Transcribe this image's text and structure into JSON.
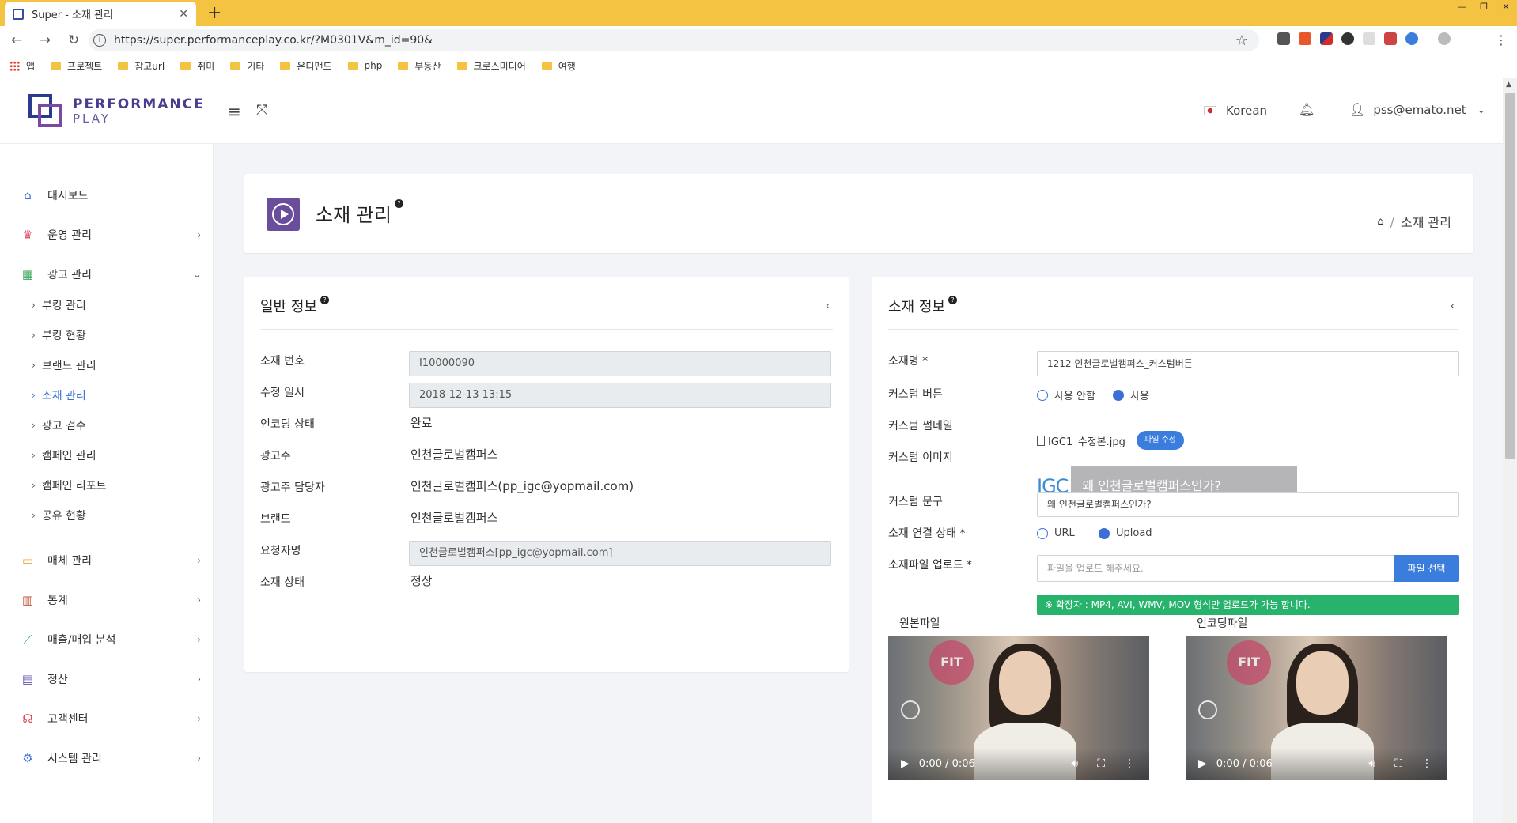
{
  "browser": {
    "tab_title": "Super - 소재 관리",
    "url": "https://super.performanceplay.co.kr/?M0301V&m_id=90&",
    "bookmarks": [
      "앱",
      "프로젝트",
      "참고url",
      "취미",
      "기타",
      "온디맨드",
      "php",
      "부동산",
      "크로스미디어",
      "여행"
    ]
  },
  "header": {
    "logo_line1": "PERFORMANCE",
    "logo_line2": "PLAY",
    "language": "Korean",
    "user_email": "pss@emato.net"
  },
  "sidebar": {
    "items": [
      {
        "label": "대시보드",
        "icon": "home-icon"
      },
      {
        "label": "운영 관리",
        "icon": "crown-icon"
      },
      {
        "label": "광고 관리",
        "icon": "grid-icon"
      },
      {
        "label": "매체 관리",
        "icon": "monitor-icon"
      },
      {
        "label": "통계",
        "icon": "bar-chart-icon"
      },
      {
        "label": "매출/매입 분석",
        "icon": "line-chart-icon"
      },
      {
        "label": "정산",
        "icon": "calculator-icon"
      },
      {
        "label": "고객센터",
        "icon": "headset-icon"
      },
      {
        "label": "시스템 관리",
        "icon": "gear-icon"
      }
    ],
    "sub_items": [
      "부킹 관리",
      "부킹 현황",
      "브랜드 관리",
      "소재 관리",
      "광고 검수",
      "캠페인 관리",
      "캠페인 리포트",
      "공유 현황"
    ],
    "active_sub": "소재 관리",
    "active_color": "#3b6fd6"
  },
  "page": {
    "title": "소재 관리",
    "breadcrumb": "소재 관리"
  },
  "general": {
    "title": "일반 정보",
    "rows": {
      "material_no_label": "소재 번호",
      "material_no": "I10000090",
      "modified_label": "수정 일시",
      "modified": "2018-12-13 13:15",
      "encoding_label": "인코딩 상태",
      "encoding": "완료",
      "advertiser_label": "광고주",
      "advertiser": "인천글로벌캠퍼스",
      "manager_label": "광고주 담당자",
      "manager": "인천글로벌캠퍼스(pp_igc@yopmail.com)",
      "brand_label": "브랜드",
      "brand": "인천글로벌캠퍼스",
      "requester_label": "요청자명",
      "requester": "인천글로벌캠퍼스[pp_igc@yopmail.com]",
      "status_label": "소재 상태",
      "status": "정상"
    }
  },
  "material": {
    "title": "소재 정보",
    "name_label": "소재명 *",
    "name_value": "1212 인천글로벌캠퍼스_커스텀버튼",
    "button_label": "커스텀 버튼",
    "button_opt1": "사용 안함",
    "button_opt2": "사용",
    "thumb_label": "커스텀 썸네일",
    "thumb_file": "IGC1_수정본.jpg",
    "thumb_edit": "파일 수정",
    "image_label": "커스텀 이미지",
    "image_logo": "IGC",
    "image_text": "왜 인천글로벌캠퍼스인가?",
    "phrase_label": "커스텀 문구",
    "phrase_value": "왜 인천글로벌캠퍼스인가?",
    "link_label": "소재 연결 상태 *",
    "link_opt1": "URL",
    "link_opt2": "Upload",
    "upload_label": "소재파일 업로드 *",
    "upload_placeholder": "파일을 업로드 해주세요.",
    "upload_button": "파일 선택",
    "notice": "※ 확장자 : MP4, AVI, WMV, MOV 형식만 업로드가 가능 합니다.",
    "original_label": "원본파일",
    "encoded_label": "인코딩파일",
    "video_time": "0:00 / 0:06",
    "video_logo": "FIT",
    "notice_color": "#28b36d",
    "button_color": "#3b7ddd"
  }
}
